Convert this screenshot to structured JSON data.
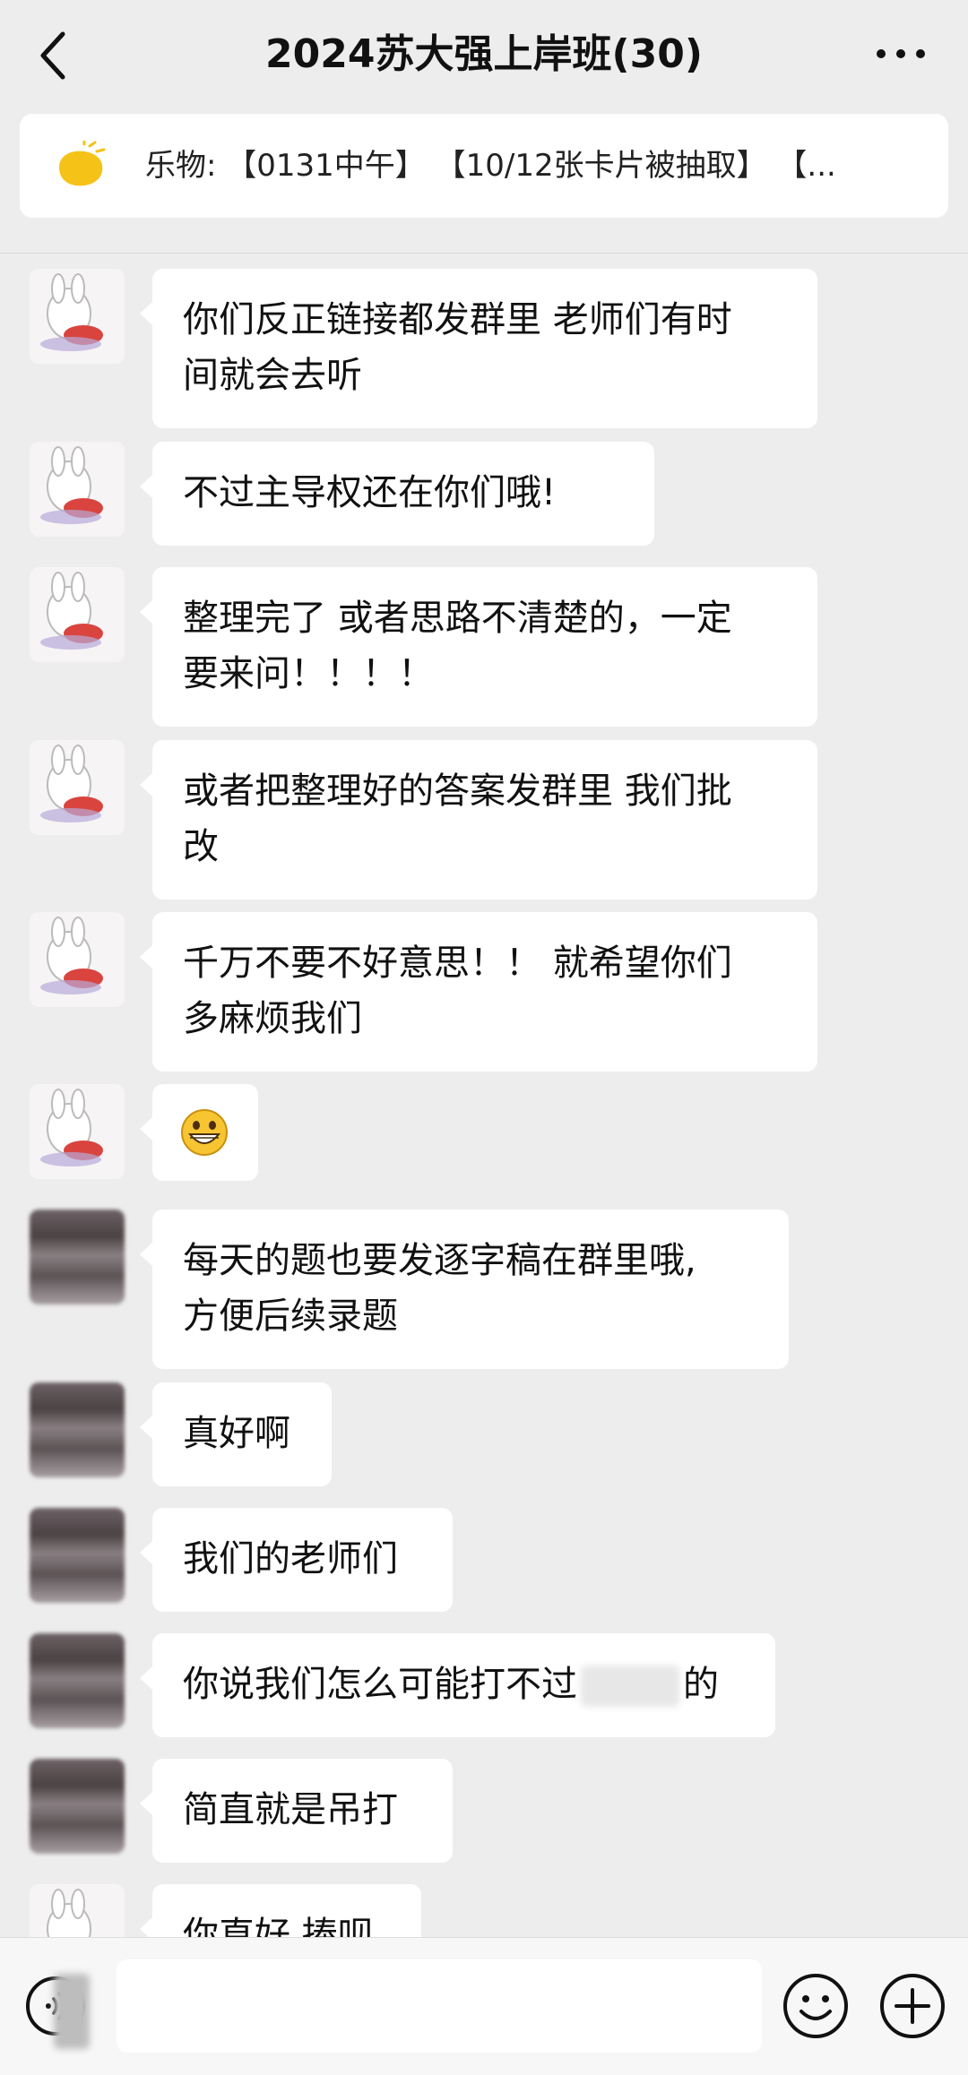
{
  "header": {
    "title": "2024苏大强上岸班(30)",
    "back_icon": "chevron-left-icon",
    "more_icon": "more-dots-icon"
  },
  "notice": {
    "icon": "megaphone-icon",
    "text": "乐物: 【0131中午】 【10/12张卡片被抽取】 【..."
  },
  "messages": [
    {
      "avatar": "bunny-avatar",
      "text_lines": [
        "你们反正链接都发群里 老师们有时",
        "间就会去听"
      ]
    },
    {
      "avatar": "bunny-avatar",
      "text_lines": [
        "不过主导权还在你们哦!"
      ]
    },
    {
      "avatar": "bunny-avatar",
      "text_lines": [
        "整理完了 或者思路不清楚的，一定",
        "要来问！！！！"
      ]
    },
    {
      "avatar": "bunny-avatar",
      "text_lines": [
        "或者把整理好的答案发群里 我们批",
        "改"
      ]
    },
    {
      "avatar": "bunny-avatar",
      "text_lines": [
        "千万不要不好意思！！ 就希望你们",
        "多麻烦我们"
      ]
    },
    {
      "avatar": "bunny-avatar",
      "emoji": "grinning-face-icon"
    },
    {
      "avatar": "blurred-avatar",
      "text_lines": [
        "每天的题也要发逐字稿在群里哦,",
        "方便后续录题"
      ]
    },
    {
      "avatar": "blurred-avatar",
      "text_lines": [
        "真好啊"
      ]
    },
    {
      "avatar": "blurred-avatar",
      "text_lines": [
        "我们的老师们"
      ]
    },
    {
      "avatar": "blurred-avatar",
      "text_lines": [
        "你说我们怎么可能打不过",
        "的"
      ]
    },
    {
      "avatar": "blurred-avatar",
      "text_lines": [
        "简直就是吊打"
      ]
    },
    {
      "avatar": "bunny-avatar",
      "text_lines": [
        "你直好 捧呗"
      ]
    }
  ],
  "input_bar": {
    "voice_icon": "voice-icon",
    "emoji_icon": "emoji-icon",
    "plus_icon": "plus-circle-icon",
    "input_value": ""
  }
}
